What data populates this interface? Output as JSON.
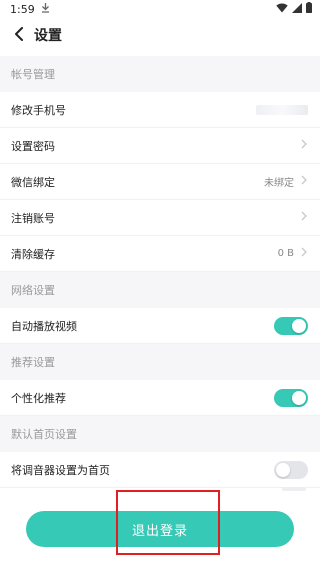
{
  "status_bar": {
    "time": "1:59"
  },
  "header": {
    "title": "设置"
  },
  "sections": {
    "account": "帐号管理",
    "network": "网络设置",
    "recommend": "推荐设置",
    "default_home": "默认首页设置"
  },
  "rows": {
    "change_phone": {
      "label": "修改手机号"
    },
    "set_password": {
      "label": "设置密码"
    },
    "wechat": {
      "label": "微信绑定",
      "value": "未绑定"
    },
    "cancel_account": {
      "label": "注销账号"
    },
    "clear_cache": {
      "label": "清除缓存",
      "value": "0 B"
    },
    "autoplay": {
      "label": "自动播放视频",
      "toggle": "on"
    },
    "personalized": {
      "label": "个性化推荐",
      "toggle": "on"
    },
    "tuner_home": {
      "label": "将调音器设置为首页",
      "toggle": "off"
    }
  },
  "logout": {
    "label": "退出登录"
  },
  "colors": {
    "accent": "#36c9b5",
    "highlight": "#e02020",
    "section_bg": "#f6f6f8"
  }
}
